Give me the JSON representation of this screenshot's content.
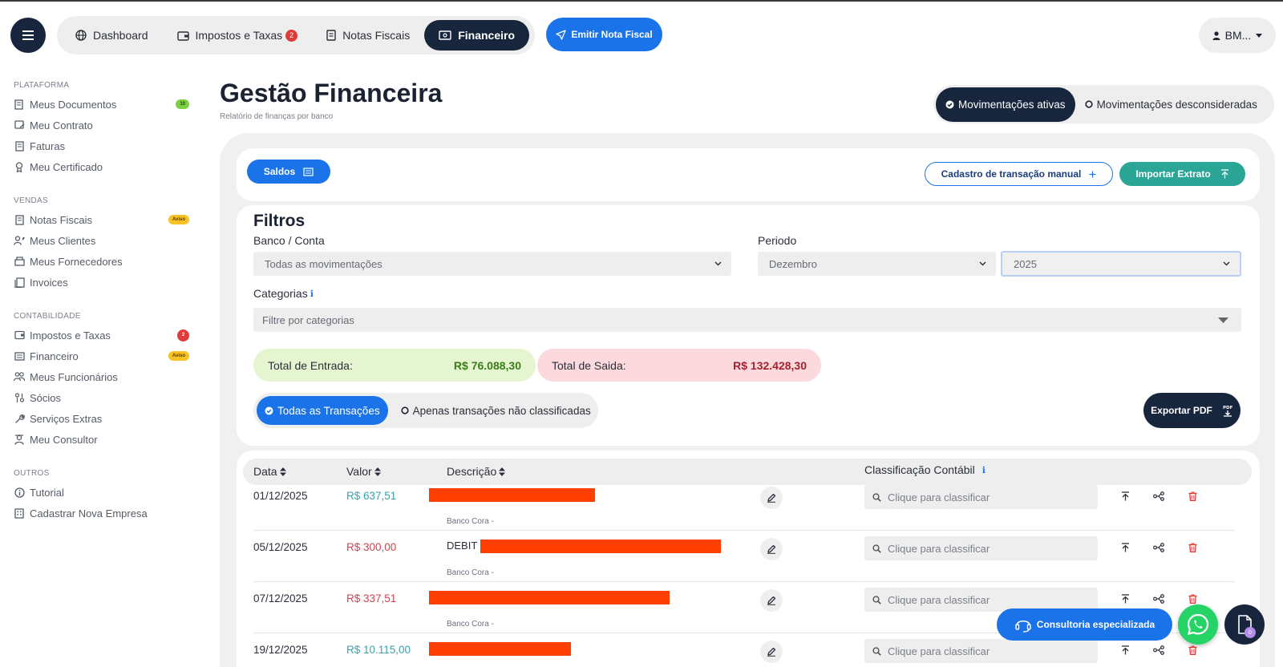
{
  "nav": {
    "items": [
      {
        "label": "Dashboard",
        "icon": "globe-icon"
      },
      {
        "label": "Impostos e Taxas",
        "icon": "wallet-icon",
        "badge": "2"
      },
      {
        "label": "Notas Fiscais",
        "icon": "receipt-icon"
      },
      {
        "label": "Financeiro",
        "icon": "money-icon",
        "active": true
      }
    ],
    "emit_label": "Emitir Nota Fiscal",
    "user_label": "BM..."
  },
  "sidebar": {
    "plataforma": {
      "title": "PLATAFORMA",
      "items": [
        {
          "label": "Meus Documentos",
          "badge": "10"
        },
        {
          "label": "Meu Contrato"
        },
        {
          "label": "Faturas"
        },
        {
          "label": "Meu Certificado"
        }
      ]
    },
    "vendas": {
      "title": "VENDAS",
      "items": [
        {
          "label": "Notas Fiscais",
          "badge": "Aviso"
        },
        {
          "label": "Meus Clientes"
        },
        {
          "label": "Meus Fornecedores"
        },
        {
          "label": "Invoices"
        }
      ]
    },
    "contabilidade": {
      "title": "CONTABILIDADE",
      "items": [
        {
          "label": "Impostos e Taxas",
          "badge": "2"
        },
        {
          "label": "Financeiro",
          "badge": "Aviso"
        },
        {
          "label": "Meus Funcionários"
        },
        {
          "label": "Sócios"
        },
        {
          "label": "Serviços Extras"
        },
        {
          "label": "Meu Consultor"
        }
      ]
    },
    "outros": {
      "title": "OUTROS",
      "items": [
        {
          "label": "Tutorial"
        },
        {
          "label": "Cadastrar Nova Empresa"
        }
      ]
    }
  },
  "header": {
    "title": "Gestão Financeira",
    "subtitle": "Relatório de finanças por banco",
    "mov_active": "Movimentações ativas",
    "mov_ignored": "Movimentações desconsideradas"
  },
  "actions": {
    "saldos": "Saldos",
    "manual": "Cadastro de transação manual",
    "import": "Importar Extrato"
  },
  "filters": {
    "title": "Filtros",
    "bank_label": "Banco / Conta",
    "bank_value": "Todas as movimentações",
    "period_label": "Periodo",
    "month_value": "Dezembro",
    "year_value": "2025",
    "categories_label": "Categorias",
    "categories_placeholder": "Filtre por categorias"
  },
  "totals": {
    "in_label": "Total de Entrada:",
    "in_value": "R$ 76.088,30",
    "out_label": "Total de Saida:",
    "out_value": "R$ 132.428,30"
  },
  "tx_filter": {
    "all": "Todas as Transações",
    "unclassified": "Apenas transações não classificadas"
  },
  "export_label": "Exportar PDF",
  "table": {
    "headers": {
      "date": "Data",
      "value": "Valor",
      "desc": "Descrição",
      "class": "Classificação Contábil"
    },
    "classify_placeholder": "Clique para classificar",
    "rows": [
      {
        "date": "01/12/2025",
        "value": "R$ 637,51",
        "type": "in",
        "desc_prefix": "",
        "bank": "Banco Cora -"
      },
      {
        "date": "05/12/2025",
        "value": "R$ 300,00",
        "type": "out",
        "desc_prefix": "DEBIT",
        "bank": "Banco Cora -"
      },
      {
        "date": "07/12/2025",
        "value": "R$ 337,51",
        "type": "out",
        "desc_prefix": "",
        "bank": "Banco Cora -"
      },
      {
        "date": "19/12/2025",
        "value": "R$ 10.115,00",
        "type": "in",
        "desc_prefix": "",
        "bank": ""
      }
    ]
  },
  "floating": {
    "consult": "Consultoria especializada",
    "doc_badge": "0"
  },
  "colors": {
    "navy": "#17253d",
    "blue": "#1a73e8",
    "teal": "#2aa596",
    "in_value": "#3aa1b0",
    "out_value": "#d0434f"
  }
}
